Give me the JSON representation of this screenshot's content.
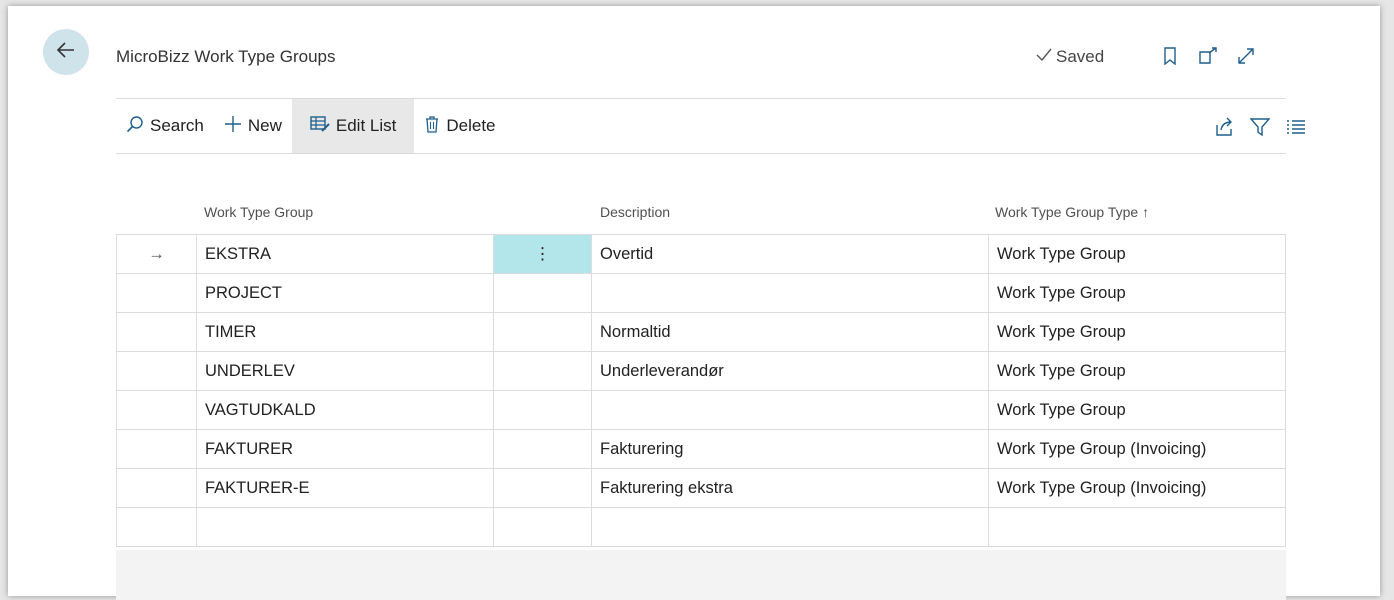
{
  "header": {
    "title": "MicroBizz Work Type Groups",
    "saved_label": "Saved"
  },
  "actions": {
    "search": "Search",
    "new": "New",
    "edit_list": "Edit List",
    "delete": "Delete"
  },
  "columns": {
    "group": "Work Type Group",
    "description": "Description",
    "type": "Work Type Group Type ↑"
  },
  "rows": [
    {
      "indicator": "→",
      "group": "EKSTRA",
      "menu": "⋮",
      "description": "Overtid",
      "type": "Work Type Group"
    },
    {
      "indicator": "",
      "group": "PROJECT",
      "menu": "",
      "description": "",
      "type": "Work Type Group"
    },
    {
      "indicator": "",
      "group": "TIMER",
      "menu": "",
      "description": "Normaltid",
      "type": "Work Type Group"
    },
    {
      "indicator": "",
      "group": "UNDERLEV",
      "menu": "",
      "description": "Underleverandør",
      "type": "Work Type Group"
    },
    {
      "indicator": "",
      "group": "VAGTUDKALD",
      "menu": "",
      "description": "",
      "type": "Work Type Group"
    },
    {
      "indicator": "",
      "group": "FAKTURER",
      "menu": "",
      "description": "Fakturering",
      "type": "Work Type Group (Invoicing)"
    },
    {
      "indicator": "",
      "group": "FAKTURER-E",
      "menu": "",
      "description": "Fakturering ekstra",
      "type": "Work Type Group (Invoicing)"
    },
    {
      "indicator": "",
      "group": "",
      "menu": "",
      "description": "",
      "type": ""
    }
  ],
  "icons": {
    "back": "arrow-left-icon",
    "check": "check-icon",
    "bookmark": "bookmark-icon",
    "open_new": "open-in-new-window-icon",
    "expand": "expand-icon",
    "search": "search-icon",
    "new": "plus-icon",
    "edit_list": "edit-list-icon",
    "delete": "trash-icon",
    "share": "share-icon",
    "filter": "filter-icon",
    "list": "list-view-icon"
  },
  "colors": {
    "back_button": "#cfe3eb",
    "selected_cell": "#b3e6ea",
    "active_action": "#e8e8e8",
    "accent_icon": "#1f5f8b"
  }
}
